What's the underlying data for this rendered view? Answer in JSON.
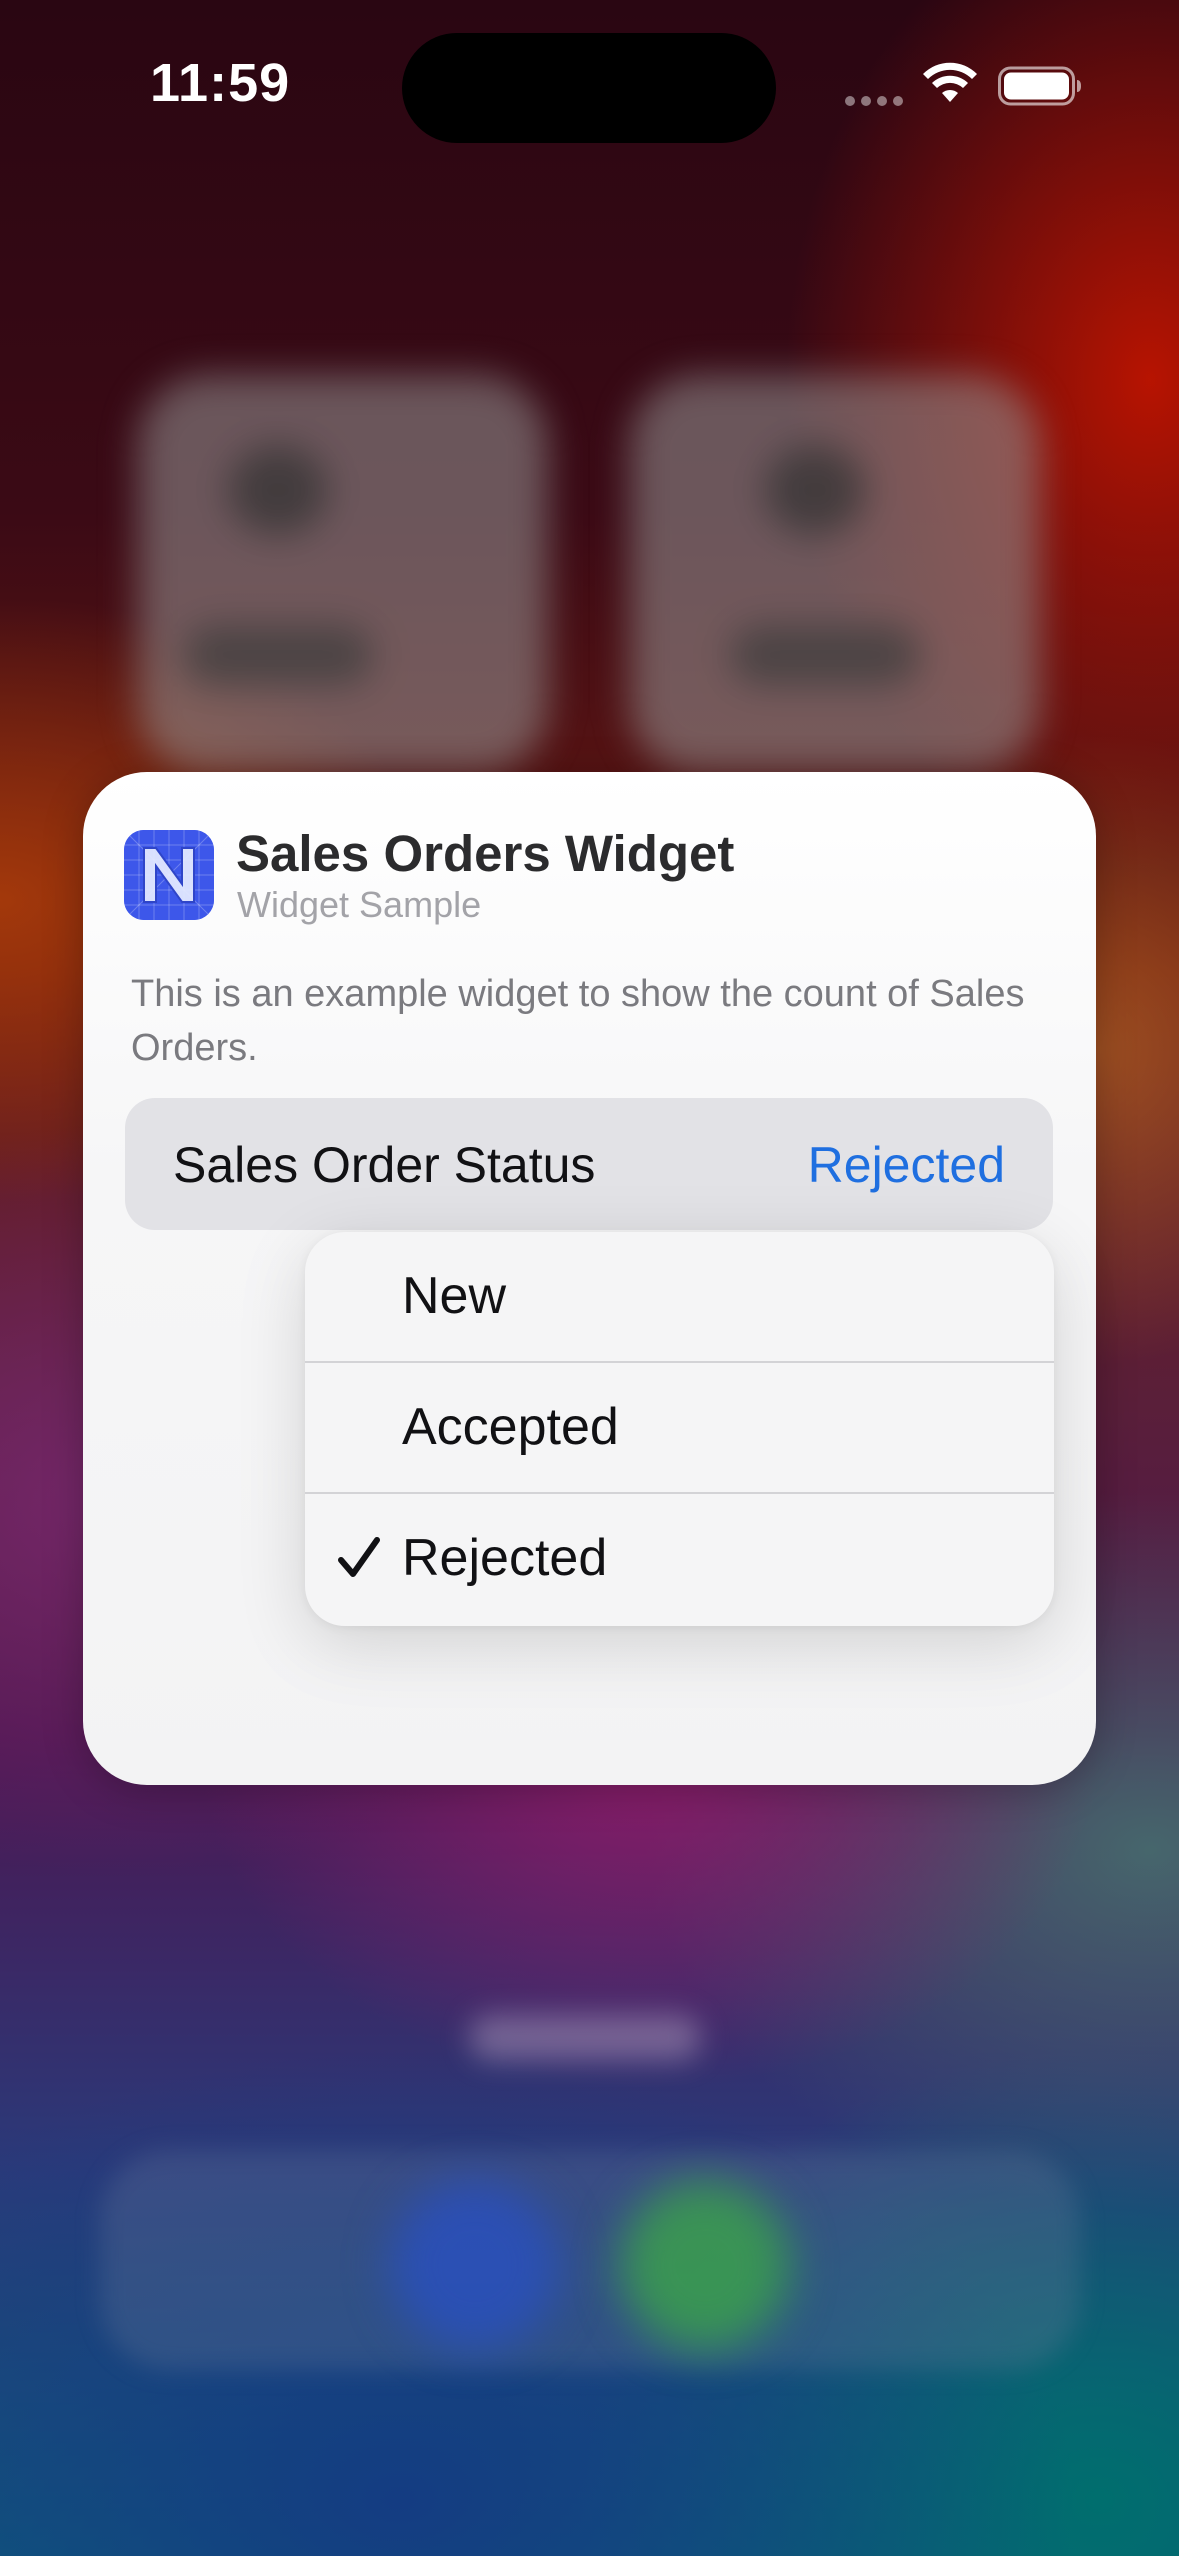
{
  "status_bar": {
    "time": "11:59",
    "icons": [
      "signal-dots-icon",
      "wifi-icon",
      "battery-icon"
    ]
  },
  "widget_config": {
    "app_name": "Sales Orders Widget",
    "app_subtitle": "Widget Sample",
    "description": "This is an example widget to show the count of Sales Orders.",
    "parameter": {
      "label": "Sales Order Status",
      "value": "Rejected"
    }
  },
  "menu": {
    "options": [
      {
        "label": "New",
        "selected": false
      },
      {
        "label": "Accepted",
        "selected": false
      },
      {
        "label": "Rejected",
        "selected": true
      }
    ]
  },
  "colors": {
    "accent": "#1f6fe0",
    "app_icon": "#3d57ea"
  }
}
